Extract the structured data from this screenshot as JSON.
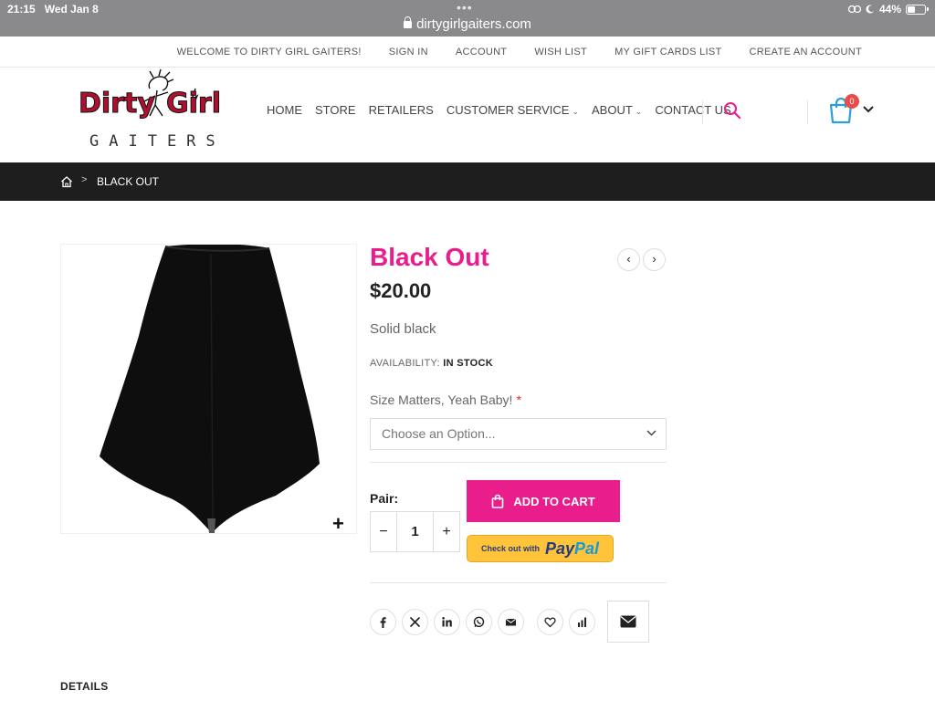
{
  "status_bar": {
    "time": "21:15",
    "date": "Wed Jan 8",
    "url": "dirtygirlgaiters.com",
    "battery": "44%"
  },
  "top_links": [
    "WELCOME TO DIRTY GIRL GAITERS!",
    "SIGN IN",
    "ACCOUNT",
    "WISH LIST",
    "MY GIFT CARDS LIST",
    "CREATE AN ACCOUNT"
  ],
  "logo": {
    "line1_a": "Dirty",
    "line1_b": "Girl",
    "line2": "GAITERS"
  },
  "nav": {
    "home": "HOME",
    "store": "STORE",
    "retailers": "RETAILERS",
    "customer_service": "CUSTOMER SERVICE",
    "about": "ABOUT",
    "contact": "CONTACT US"
  },
  "cart": {
    "count": "0"
  },
  "breadcrumb": {
    "current": "BLACK OUT"
  },
  "product": {
    "title": "Black Out",
    "price": "$20.00",
    "description": "Solid black",
    "availability_label": "AVAILABILITY:",
    "availability_value": "IN STOCK",
    "option_label": "Size Matters, Yeah Baby!",
    "required_mark": "*",
    "select_placeholder": "Choose an Option...",
    "qty_label": "Pair:",
    "qty": "1",
    "add_to_cart": "ADD TO CART",
    "paypal_checkout": "Check out with",
    "paypal_brand_a": "Pay",
    "paypal_brand_b": "Pal"
  },
  "details_heading": "DETAILS",
  "colors": {
    "accent": "#e91e8c",
    "dark_band": "#1e1e1e",
    "cart_icon": "#2a9fd8",
    "badge": "#e94b4b",
    "paypal": "#ffc439"
  }
}
